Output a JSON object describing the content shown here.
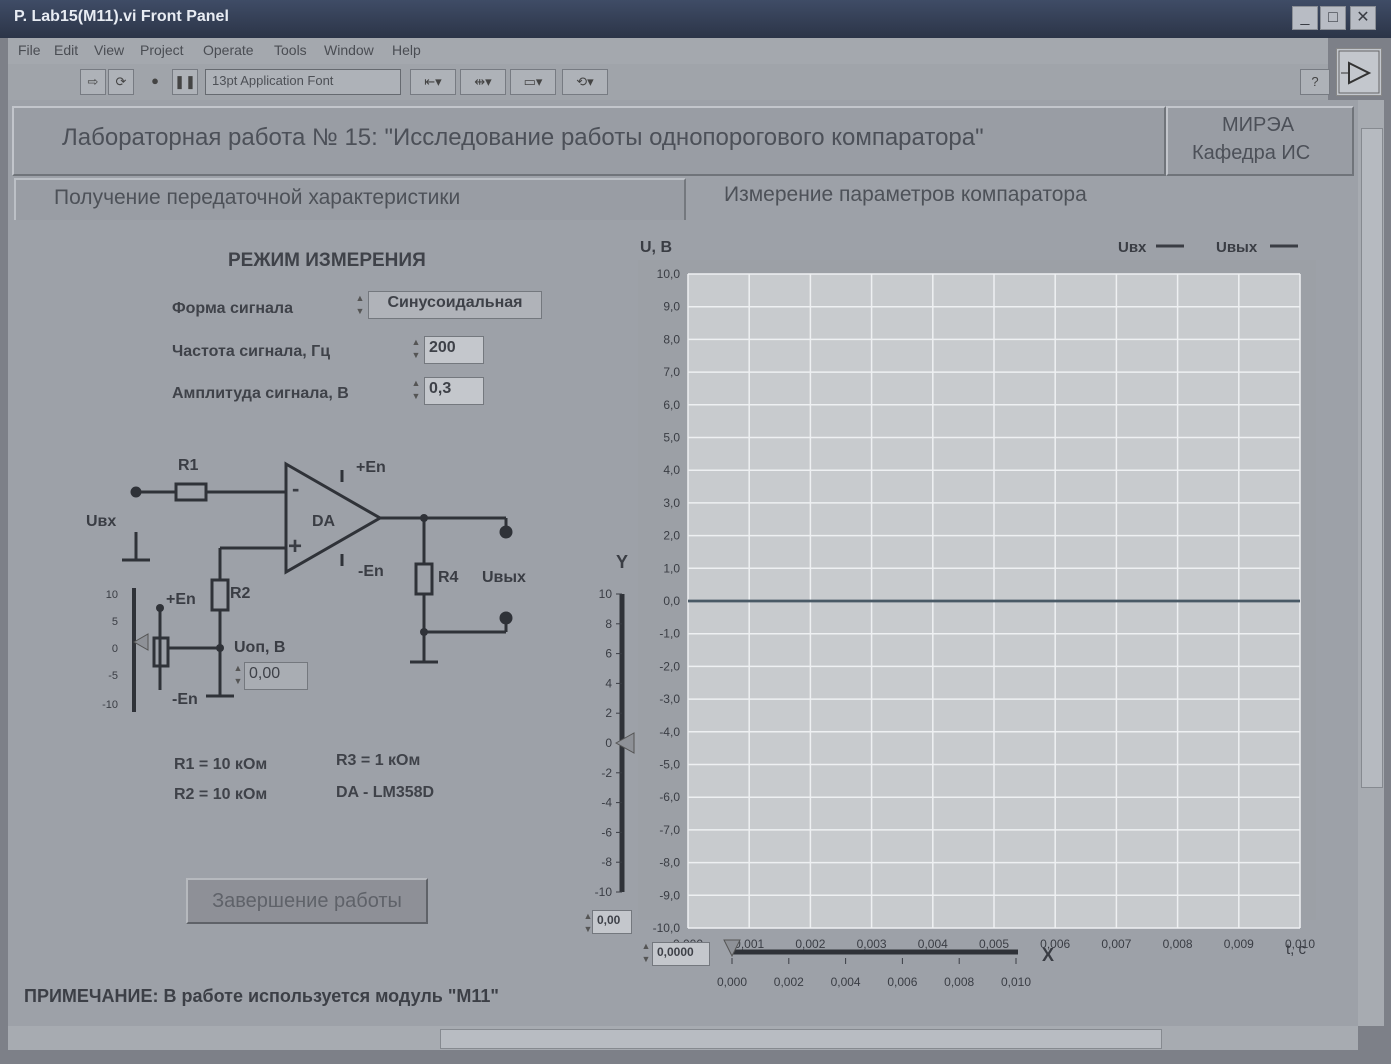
{
  "window": {
    "title": "P. Lab15(M11).vi Front Panel",
    "buttons": {
      "minimize": "_",
      "maximize": "□",
      "close": "✕"
    }
  },
  "menu": [
    "File",
    "Edit",
    "View",
    "Project",
    "Operate",
    "Tools",
    "Window",
    "Help"
  ],
  "toolbar": {
    "font_selector": "13pt Application Font",
    "help": "?",
    "logo": "Lab\nVI"
  },
  "header": {
    "title": "Лабораторная работа № 15: \"Исследование работы однопорогового компаратора\"",
    "org_line1": "МИРЭА",
    "org_line2": "Кафедра ИС"
  },
  "tabs": {
    "tab1": "Получение передаточной характеристики",
    "tab2": "Измерение параметров компаратора"
  },
  "measure": {
    "heading": "РЕЖИМ ИЗМЕРЕНИЯ",
    "signal_form_label": "Форма сигнала",
    "signal_form_value": "Синусоидальная",
    "frequency_label": "Частота сигнала, Гц",
    "frequency_value": "200",
    "amplitude_label": "Амплитуда сигнала, В",
    "amplitude_value": "0,3"
  },
  "circuit": {
    "r1": "R1",
    "r2": "R2",
    "r4": "R4",
    "da": "DA",
    "minus": "-",
    "plus": "+",
    "en_plus_top": "+En",
    "en_minus": "-En",
    "u_in": "Uвх",
    "u_out": "Uвых",
    "pot_en_plus": "+En",
    "pot_en_minus": "-En",
    "uop_label": "Uоп, В",
    "uop_value": "0,00",
    "pot_ticks": [
      "10",
      "5",
      "0",
      "-5",
      "-10"
    ],
    "spec_r1": "R1 = 10 кОм",
    "spec_r2": "R2 = 10 кОм",
    "spec_r3": "R3 = 1 кОм",
    "spec_da": "DA - LM358D"
  },
  "stop_button": "Завершение работы",
  "note": "ПРИМЕЧАНИЕ: В работе используется модуль \"М11\"",
  "y_slider": {
    "label": "Y",
    "ticks": [
      "10",
      "8",
      "6",
      "4",
      "2",
      "0",
      "-2",
      "-4",
      "-6",
      "-8",
      "-10"
    ],
    "value": 0.0,
    "value_text": "0,00"
  },
  "x_slider": {
    "label": "X",
    "ticks": [
      "0,000",
      "0,002",
      "0,004",
      "0,006",
      "0,008",
      "0,010"
    ],
    "value": 0.0,
    "value_text": "0,0000"
  },
  "chart_data": {
    "type": "line",
    "ylabel": "U, В",
    "xlabel": "t, с",
    "legend": [
      "Uвх",
      "Uвых"
    ],
    "legend_position": "top-right",
    "grid": true,
    "xlim": [
      0,
      0.01
    ],
    "ylim": [
      -10,
      10
    ],
    "x_ticks": [
      "0,000",
      "0,001",
      "0,002",
      "0,003",
      "0,004",
      "0,005",
      "0,006",
      "0,007",
      "0,008",
      "0,009",
      "0,010"
    ],
    "y_ticks": [
      "10,0",
      "9,0",
      "8,0",
      "7,0",
      "6,0",
      "5,0",
      "4,0",
      "3,0",
      "2,0",
      "1,0",
      "0,0",
      "-1,0",
      "-2,0",
      "-3,0",
      "-4,0",
      "-5,0",
      "-6,0",
      "-7,0",
      "-8,0",
      "-9,0",
      "-10,0"
    ],
    "series": [
      {
        "name": "Uвх",
        "x": [
          0,
          0.01
        ],
        "y": [
          0,
          0
        ]
      },
      {
        "name": "Uвых",
        "x": [
          0,
          0.01
        ],
        "y": [
          0,
          0
        ]
      }
    ],
    "colors": {
      "plot_bg": "#c8cbce",
      "grid": "#eef0f2",
      "trace": "#4a5a66"
    }
  }
}
